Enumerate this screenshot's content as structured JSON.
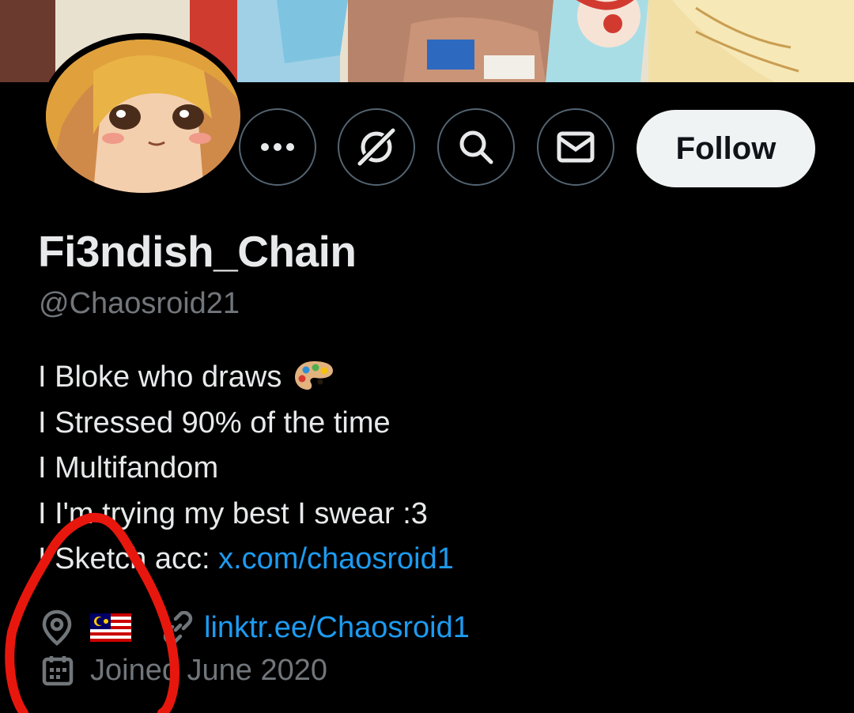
{
  "profile": {
    "display_name": "Fi3ndish_Chain",
    "handle": "@Chaosroid21",
    "avatar_icon": "avatar-image"
  },
  "actions": {
    "more_icon": "more-horizontal-icon",
    "grok_icon": "grok-icon",
    "search_icon": "search-icon",
    "message_icon": "envelope-icon",
    "follow_label": "Follow"
  },
  "bio": {
    "line1": "I Bloke who draws",
    "line1_emoji": "artist-palette-emoji",
    "line2": "I Stressed 90% of the time",
    "line3": "I Multifandom",
    "line4": "I I'm trying my best I swear :3",
    "line5_prefix": "I Sketch acc: ",
    "line5_link": "x.com/chaosroid1"
  },
  "meta": {
    "location_icon": "location-pin-icon",
    "location_flag": "malaysia-flag",
    "link_icon": "link-icon",
    "website": "linktr.ee/Chaosroid1",
    "calendar_icon": "calendar-icon",
    "joined": "Joined June 2020"
  },
  "colors": {
    "background": "#000000",
    "text_primary": "#e7e9ea",
    "text_secondary": "#71767b",
    "link": "#1d9bf0",
    "button_border": "#536471",
    "follow_bg": "#eff3f4",
    "annotation": "#e8170e"
  }
}
